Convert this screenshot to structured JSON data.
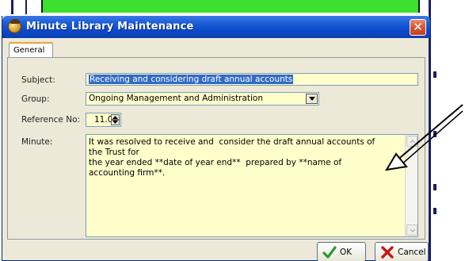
{
  "window": {
    "title": "Minute Library Maintenance",
    "close_symbol": "✕"
  },
  "tabs": [
    {
      "label": "General",
      "active": true
    }
  ],
  "form": {
    "subject_label": "Subject:",
    "subject_value": "Receiving and considering draft annual accounts",
    "group_label": "Group:",
    "group_value": "Ongoing Management and Administration",
    "reference_label": "Reference No:",
    "reference_value": "11.00",
    "minute_label": "Minute:",
    "minute_value": "It was resolved to receive and  consider the draft annual accounts of the Trust for\nthe year ended **date of year end**  prepared by **name of accounting firm**."
  },
  "buttons": {
    "ok_label": "OK",
    "cancel_label": "Cancel"
  },
  "icons": {
    "app": "app-icon",
    "close": "close-icon",
    "dropdown": "chevron-down-icon",
    "spin_up": "spin-up-icon",
    "spin_down": "spin-down-icon",
    "ok": "checkmark-icon",
    "cancel": "cross-icon",
    "annotation": "arrow-annotation"
  },
  "colors": {
    "title_bar": "#0a48c8",
    "field_background": "#ffffcc",
    "selection": "#316ac5",
    "ok_icon": "#2e9a2a",
    "cancel_icon": "#c41818",
    "background_app_bar": "#3de02f"
  }
}
